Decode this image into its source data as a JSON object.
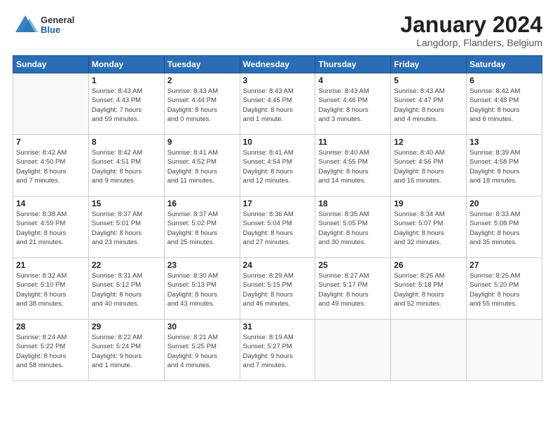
{
  "logo": {
    "general": "General",
    "blue": "Blue"
  },
  "title": "January 2024",
  "subtitle": "Langdorp, Flanders, Belgium",
  "days_header": [
    "Sunday",
    "Monday",
    "Tuesday",
    "Wednesday",
    "Thursday",
    "Friday",
    "Saturday"
  ],
  "weeks": [
    [
      {
        "day": "",
        "info": ""
      },
      {
        "day": "1",
        "info": "Sunrise: 8:43 AM\nSunset: 4:43 PM\nDaylight: 7 hours\nand 59 minutes."
      },
      {
        "day": "2",
        "info": "Sunrise: 8:43 AM\nSunset: 4:44 PM\nDaylight: 8 hours\nand 0 minutes."
      },
      {
        "day": "3",
        "info": "Sunrise: 8:43 AM\nSunset: 4:45 PM\nDaylight: 8 hours\nand 1 minute."
      },
      {
        "day": "4",
        "info": "Sunrise: 8:43 AM\nSunset: 4:46 PM\nDaylight: 8 hours\nand 3 minutes."
      },
      {
        "day": "5",
        "info": "Sunrise: 8:43 AM\nSunset: 4:47 PM\nDaylight: 8 hours\nand 4 minutes."
      },
      {
        "day": "6",
        "info": "Sunrise: 8:42 AM\nSunset: 4:48 PM\nDaylight: 8 hours\nand 6 minutes."
      }
    ],
    [
      {
        "day": "7",
        "info": "Sunrise: 8:42 AM\nSunset: 4:50 PM\nDaylight: 8 hours\nand 7 minutes."
      },
      {
        "day": "8",
        "info": "Sunrise: 8:42 AM\nSunset: 4:51 PM\nDaylight: 8 hours\nand 9 minutes."
      },
      {
        "day": "9",
        "info": "Sunrise: 8:41 AM\nSunset: 4:52 PM\nDaylight: 8 hours\nand 11 minutes."
      },
      {
        "day": "10",
        "info": "Sunrise: 8:41 AM\nSunset: 4:54 PM\nDaylight: 8 hours\nand 12 minutes."
      },
      {
        "day": "11",
        "info": "Sunrise: 8:40 AM\nSunset: 4:55 PM\nDaylight: 8 hours\nand 14 minutes."
      },
      {
        "day": "12",
        "info": "Sunrise: 8:40 AM\nSunset: 4:56 PM\nDaylight: 8 hours\nand 16 minutes."
      },
      {
        "day": "13",
        "info": "Sunrise: 8:39 AM\nSunset: 4:58 PM\nDaylight: 8 hours\nand 18 minutes."
      }
    ],
    [
      {
        "day": "14",
        "info": "Sunrise: 8:38 AM\nSunset: 4:59 PM\nDaylight: 8 hours\nand 21 minutes."
      },
      {
        "day": "15",
        "info": "Sunrise: 8:37 AM\nSunset: 5:01 PM\nDaylight: 8 hours\nand 23 minutes."
      },
      {
        "day": "16",
        "info": "Sunrise: 8:37 AM\nSunset: 5:02 PM\nDaylight: 8 hours\nand 25 minutes."
      },
      {
        "day": "17",
        "info": "Sunrise: 8:36 AM\nSunset: 5:04 PM\nDaylight: 8 hours\nand 27 minutes."
      },
      {
        "day": "18",
        "info": "Sunrise: 8:35 AM\nSunset: 5:05 PM\nDaylight: 8 hours\nand 30 minutes."
      },
      {
        "day": "19",
        "info": "Sunrise: 8:34 AM\nSunset: 5:07 PM\nDaylight: 8 hours\nand 32 minutes."
      },
      {
        "day": "20",
        "info": "Sunrise: 8:33 AM\nSunset: 5:08 PM\nDaylight: 8 hours\nand 35 minutes."
      }
    ],
    [
      {
        "day": "21",
        "info": "Sunrise: 8:32 AM\nSunset: 5:10 PM\nDaylight: 8 hours\nand 38 minutes."
      },
      {
        "day": "22",
        "info": "Sunrise: 8:31 AM\nSunset: 5:12 PM\nDaylight: 8 hours\nand 40 minutes."
      },
      {
        "day": "23",
        "info": "Sunrise: 8:30 AM\nSunset: 5:13 PM\nDaylight: 8 hours\nand 43 minutes."
      },
      {
        "day": "24",
        "info": "Sunrise: 8:29 AM\nSunset: 5:15 PM\nDaylight: 8 hours\nand 46 minutes."
      },
      {
        "day": "25",
        "info": "Sunrise: 8:27 AM\nSunset: 5:17 PM\nDaylight: 8 hours\nand 49 minutes."
      },
      {
        "day": "26",
        "info": "Sunrise: 8:26 AM\nSunset: 5:18 PM\nDaylight: 8 hours\nand 52 minutes."
      },
      {
        "day": "27",
        "info": "Sunrise: 8:25 AM\nSunset: 5:20 PM\nDaylight: 8 hours\nand 55 minutes."
      }
    ],
    [
      {
        "day": "28",
        "info": "Sunrise: 8:24 AM\nSunset: 5:22 PM\nDaylight: 8 hours\nand 58 minutes."
      },
      {
        "day": "29",
        "info": "Sunrise: 8:22 AM\nSunset: 5:24 PM\nDaylight: 9 hours\nand 1 minute."
      },
      {
        "day": "30",
        "info": "Sunrise: 8:21 AM\nSunset: 5:25 PM\nDaylight: 9 hours\nand 4 minutes."
      },
      {
        "day": "31",
        "info": "Sunrise: 8:19 AM\nSunset: 5:27 PM\nDaylight: 9 hours\nand 7 minutes."
      },
      {
        "day": "",
        "info": ""
      },
      {
        "day": "",
        "info": ""
      },
      {
        "day": "",
        "info": ""
      }
    ]
  ]
}
